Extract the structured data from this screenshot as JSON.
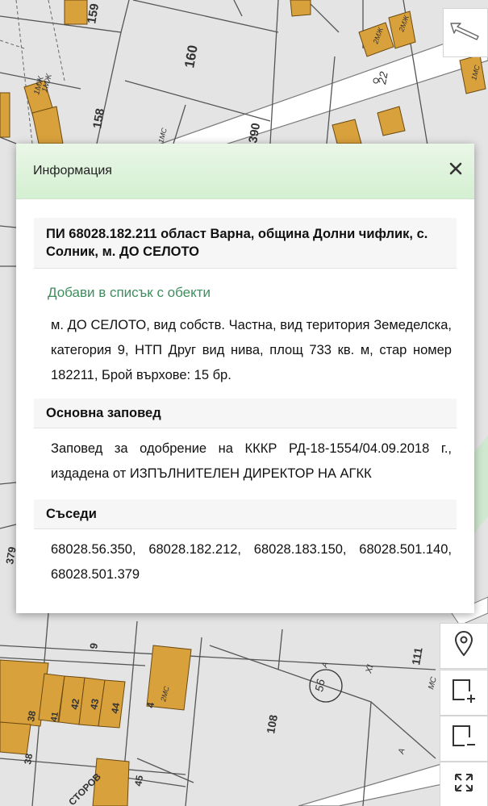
{
  "map": {
    "parcel_numbers": [
      "159",
      "160",
      "158",
      "390",
      "22",
      "379",
      "9",
      "111",
      "56",
      "108",
      "38",
      "38",
      "42",
      "43",
      "44",
      "41",
      "45",
      "1",
      "4"
    ],
    "building_labels": [
      "1МЖ",
      "1МЖ",
      "1МС",
      "2МЖ",
      "2МЖ",
      "1МС",
      "2МС",
      "МС",
      "А",
      "А",
      "XI"
    ],
    "street_label": "СТОРОВ"
  },
  "controls": {
    "overview_icon": "arrow-icon",
    "location_icon": "map-pin-icon",
    "area_add_icon": "square-plus-icon",
    "area_remove_icon": "square-minus-icon",
    "fullscreen_icon": "expand-icon"
  },
  "dialog": {
    "title": "Информация",
    "close_icon": "close-icon",
    "parcel_title": "ПИ 68028.182.211 област Варна, община Долни чифлик, с. Солник, м. ДО СЕЛОТО",
    "add_link": "Добави в списък с обекти",
    "description": "м. ДО СЕЛОТО, вид собств. Частна, вид територия Земеделска, категория 9, НТП Друг вид нива, площ 733 кв. м, стар номер 182211, Брой върхове: 15 бр.",
    "order_heading": "Основна заповед",
    "order_text": "Заповед за одобрение на КККР РД-18-1554/04.09.2018 г., издадена от ИЗПЪЛНИТЕЛЕН ДИРЕКТОР НА АГКК",
    "neighbors_heading": "Съседи",
    "neighbors_text": "68028.56.350, 68028.182.212, 68028.183.150, 68028.501.140, 68028.501.379"
  },
  "colors": {
    "building_fill": "#d9a13c",
    "link_green": "#3e8e5d",
    "header_green": "#d4efd1",
    "map_bg": "#e6e6e6"
  }
}
